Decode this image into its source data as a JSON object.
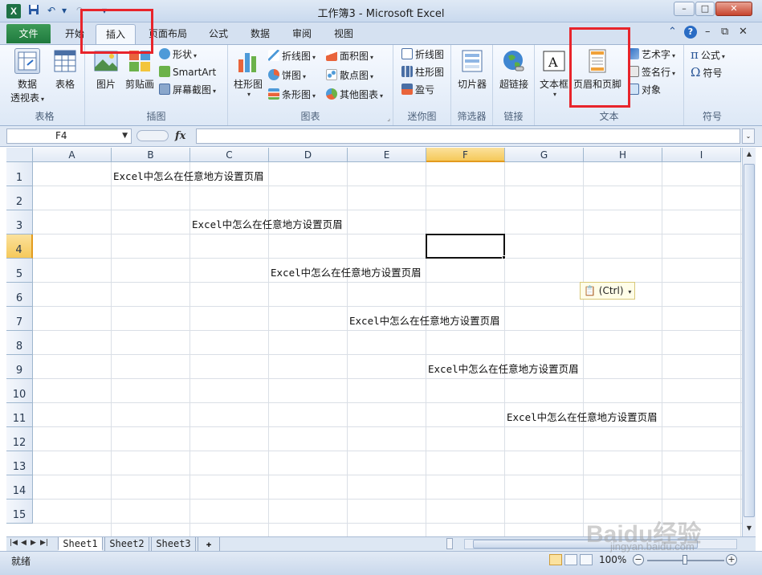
{
  "window": {
    "title": "工作簿3 - Microsoft Excel",
    "app_letter": "X",
    "min_label": "–",
    "max_label": "□",
    "close_label": "✕"
  },
  "tabs": {
    "file": "文件",
    "items": [
      "开始",
      "插入",
      "页面布局",
      "公式",
      "数据",
      "审阅",
      "视图"
    ],
    "active": "插入"
  },
  "ribbon": {
    "groups": {
      "tables": "表格",
      "illustrations": "插图",
      "charts": "图表",
      "sparklines": "迷你图",
      "filter": "筛选器",
      "links": "链接",
      "text": "文本",
      "symbols": "符号"
    },
    "buttons": {
      "pivot_l1": "数据",
      "pivot_l2": "透视表",
      "table": "表格",
      "picture": "图片",
      "clipart": "剪贴画",
      "shapes": "形状",
      "smartart": "SmartArt",
      "screenshot": "屏幕截图",
      "column_chart": "柱形图",
      "line_chart": "折线图",
      "pie_chart": "饼图",
      "bar_chart": "条形图",
      "area_chart": "面积图",
      "scatter_chart": "散点图",
      "other_chart": "其他图表",
      "spark_line": "折线图",
      "spark_column": "柱形图",
      "spark_winloss": "盈亏",
      "slicer": "切片器",
      "hyperlink": "超链接",
      "textbox": "文本框",
      "header_footer": "页眉和页脚",
      "wordart": "艺术字",
      "signature": "签名行",
      "object": "对象",
      "equation": "公式",
      "symbol": "符号"
    }
  },
  "formula_bar": {
    "name_box": "F4",
    "fx": "fx",
    "formula": ""
  },
  "grid": {
    "columns": [
      "A",
      "B",
      "C",
      "D",
      "E",
      "F",
      "G",
      "H",
      "I"
    ],
    "rows": [
      "1",
      "2",
      "3",
      "4",
      "5",
      "6",
      "7",
      "8",
      "9",
      "10",
      "11",
      "12",
      "13",
      "14",
      "15"
    ],
    "selected_cell": "F4",
    "cell_text": [
      {
        "cell": "B1",
        "text": "Excel中怎么在任意地方设置页眉"
      },
      {
        "cell": "C3",
        "text": "Excel中怎么在任意地方设置页眉"
      },
      {
        "cell": "D5",
        "text": "Excel中怎么在任意地方设置页眉"
      },
      {
        "cell": "E7",
        "text": "Excel中怎么在任意地方设置页眉"
      },
      {
        "cell": "F9",
        "text": "Excel中怎么在任意地方设置页眉"
      },
      {
        "cell": "G11",
        "text": "Excel中怎么在任意地方设置页眉"
      }
    ],
    "paste_options": "(Ctrl)"
  },
  "sheets": {
    "tabs": [
      "Sheet1",
      "Sheet2",
      "Sheet3"
    ],
    "active": "Sheet1"
  },
  "status": {
    "ready": "就绪",
    "zoom": "100%",
    "zoom_out": "−",
    "zoom_in": "+"
  },
  "watermark": {
    "logo": "Baidu经验",
    "url": "jingyan.baidu.com"
  },
  "colors": {
    "file_tab": "#1f7a3e",
    "highlight": "#e8242b",
    "selected_header": "#f5c95a"
  }
}
